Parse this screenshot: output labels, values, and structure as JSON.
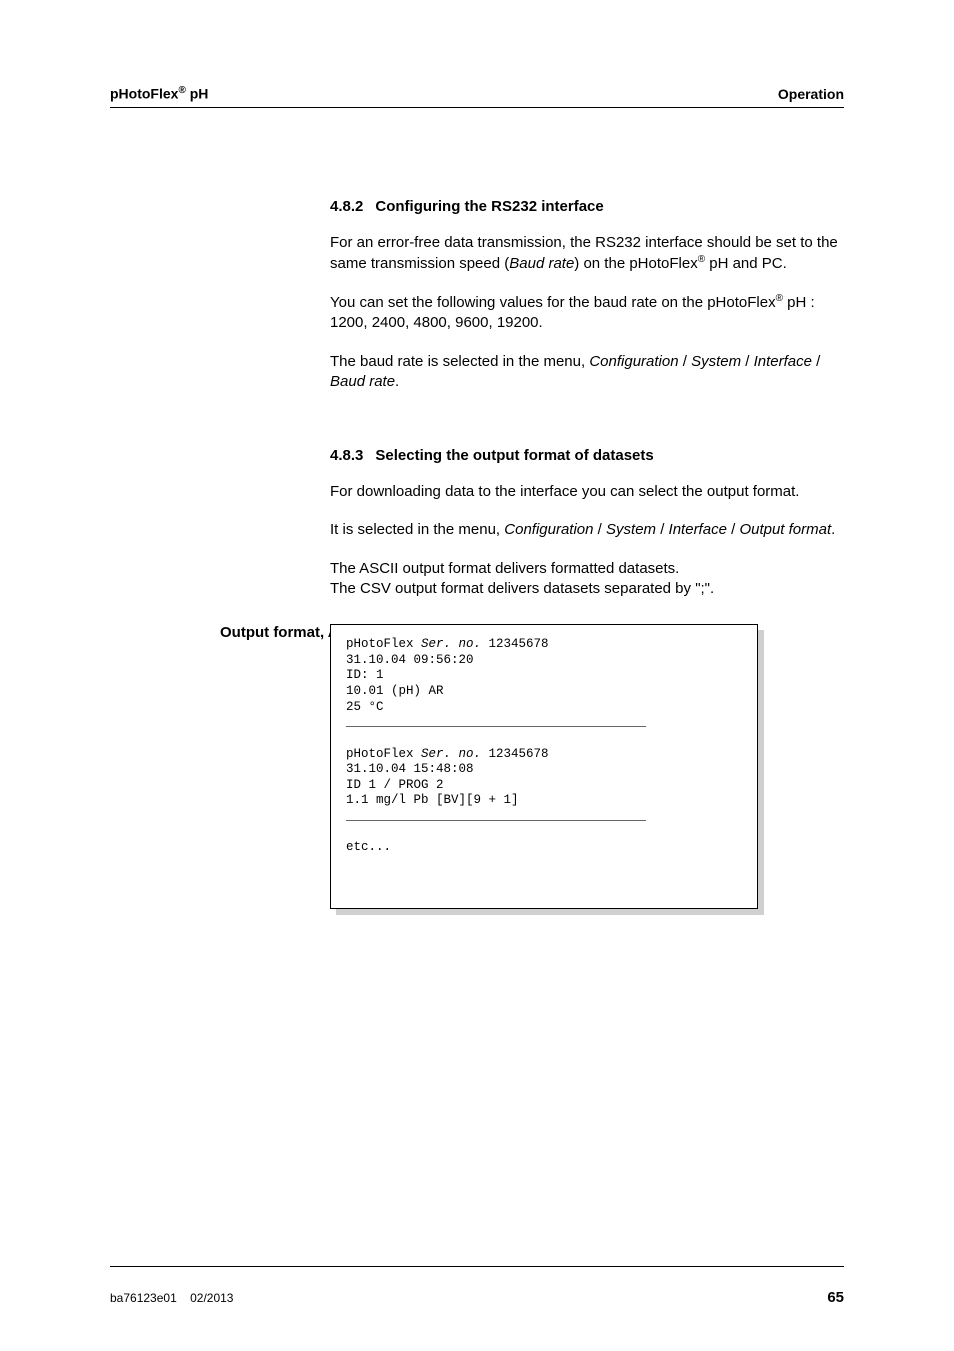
{
  "header": {
    "product_prefix": "pHotoFlex",
    "product_super": "®",
    "product_suffix": " pH",
    "section": "Operation"
  },
  "s482": {
    "num": "4.8.2",
    "title": "Configuring the RS232 interface",
    "p1_a": "For an error-free data transmission, the RS232 interface should be set to the same transmission speed (",
    "p1_b": "Baud rate",
    "p1_c": ") on the pHotoFlex",
    "p1_d": " pH and PC.",
    "p2_a": "You can set the following values for the baud rate on the pHotoFlex",
    "p2_b": " pH : 1200, 2400, 4800, 9600, 19200.",
    "p3_a": "The baud rate is selected in the menu, ",
    "p3_b": "Configuration",
    "p3_c": " / ",
    "p3_d": "System",
    "p3_e": " / ",
    "p3_f": "Interface",
    "p3_g": " / ",
    "p3_h": "Baud rate",
    "p3_i": "."
  },
  "s483": {
    "num": "4.8.3",
    "title": "Selecting the output format of datasets",
    "p1": "For downloading data to the interface you can select the output format.",
    "p2_a": "It is selected in the menu, ",
    "p2_b": "Configuration",
    "p2_c": " / ",
    "p2_d": "System",
    "p2_e": " / ",
    "p2_f": "Interface",
    "p2_g": " / ",
    "p2_h": "Output format",
    "p2_i": ".",
    "p3_a": "The ASCII output format delivers formatted datasets.",
    "p3_b": "The CSV output format delivers datasets separated by \";\"."
  },
  "sidelabel": "Output format, ASCII",
  "ascii": {
    "l1_a": "pHotoFlex ",
    "l1_b": "Ser. no.",
    "l1_c": " 12345678",
    "l2": "31.10.04 09:56:20",
    "l3": "ID: 1",
    "l4": "10.01 (pH) AR",
    "l5": "25 °C",
    "sep": "________________________________________",
    "l7_a": "pHotoFlex ",
    "l7_b": "Ser. no.",
    "l7_c": " 12345678",
    "l8": "31.10.04 15:48:08",
    "l9": "ID 1 / PROG 2",
    "l10": "1.1 mg/l Pb [BV][9 + 1]",
    "etc": "etc..."
  },
  "footer": {
    "left_a": "ba76123e01",
    "left_b": "02/2013",
    "page": "65"
  }
}
